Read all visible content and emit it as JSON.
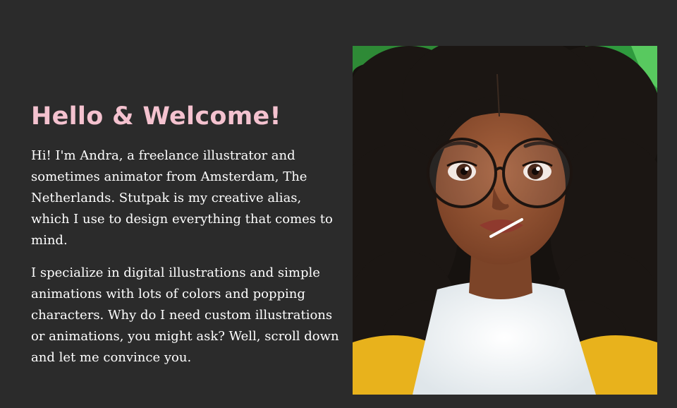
{
  "intro": {
    "heading": "Hello & Welcome!",
    "paragraphs": [
      "Hi! I'm Andra, a freelance illustrator and sometimes animator from Amsterdam, The Netherlands. Stutpak is my creative alias, which I use to design everything that comes to mind.",
      "I specialize in digital illustrations and simple animations with lots of colors and popping characters. Why do I need custom illustrations or animations, you might ask? Well, scroll down and let me convince you."
    ]
  },
  "colors": {
    "page_background": "#2b2b2b",
    "heading": "#f4c2cf",
    "body_text": "#ffffff"
  }
}
